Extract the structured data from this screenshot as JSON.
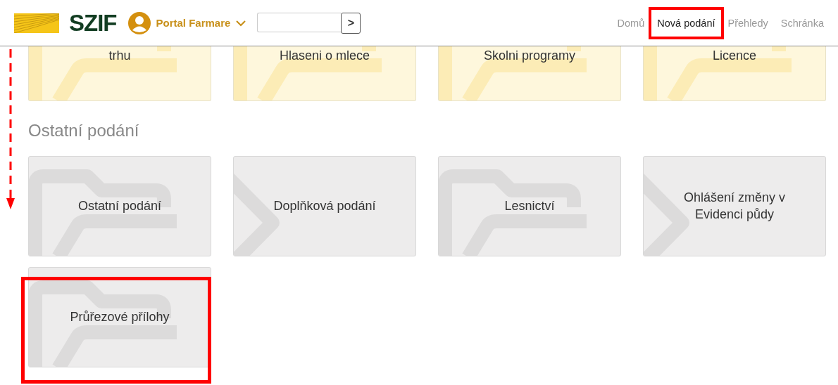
{
  "header": {
    "logo_text": "SZIF",
    "portal": "Portal Farmare",
    "search": {
      "button": ">"
    },
    "nav": [
      {
        "label": "Domů",
        "selected": false,
        "highlighted": false
      },
      {
        "label": "Nová podání",
        "selected": true,
        "highlighted": true
      },
      {
        "label": "Přehledy",
        "selected": false,
        "highlighted": false
      },
      {
        "label": "Schránka",
        "selected": false,
        "highlighted": false
      }
    ]
  },
  "sections": [
    {
      "kind": "featured",
      "tiles": [
        {
          "label": "trhu",
          "kind": "folder",
          "highlighted": false
        },
        {
          "label": "Hlaseni o mlece",
          "kind": "folder",
          "highlighted": false
        },
        {
          "label": "Skolni programy",
          "kind": "folder",
          "highlighted": false
        },
        {
          "label": "Licence",
          "kind": "folder",
          "highlighted": false
        }
      ]
    },
    {
      "kind": "other",
      "title": "Ostatní podání",
      "tiles": [
        {
          "label": "Ostatní podání",
          "kind": "folder",
          "highlighted": false
        },
        {
          "label": "Doplňková podání",
          "kind": "chevron",
          "highlighted": false
        },
        {
          "label": "Lesnictví",
          "kind": "folder",
          "highlighted": false
        },
        {
          "label": "Ohlášení změny v Evidenci půdy",
          "kind": "chevron",
          "highlighted": false
        },
        {
          "label": "Průřezové přílohy",
          "kind": "folder",
          "highlighted": true
        }
      ]
    }
  ]
}
